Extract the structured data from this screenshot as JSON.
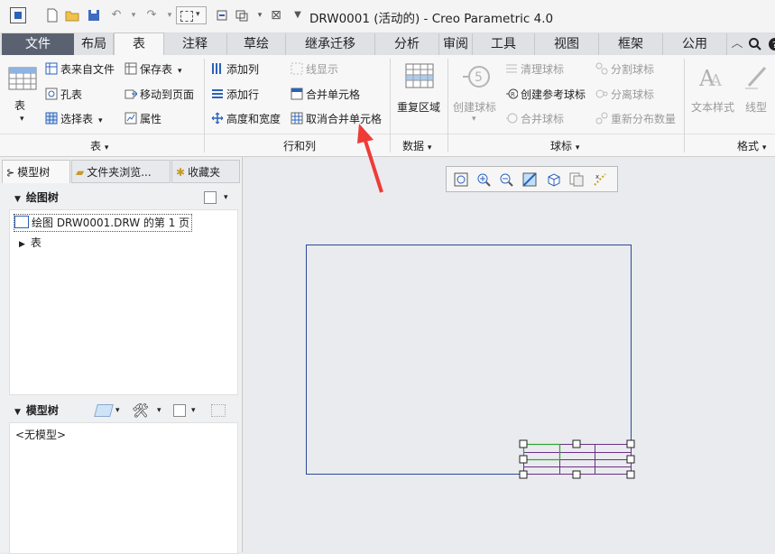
{
  "window": {
    "title": "DRW0001 (活动的) - Creo Parametric 4.0"
  },
  "tabs": [
    {
      "label": "文件"
    },
    {
      "label": "布局"
    },
    {
      "label": "表"
    },
    {
      "label": "注释"
    },
    {
      "label": "草绘"
    },
    {
      "label": "继承迁移"
    },
    {
      "label": "分析"
    },
    {
      "label": "审阅"
    },
    {
      "label": "工具"
    },
    {
      "label": "视图"
    },
    {
      "label": "框架"
    },
    {
      "label": "公用"
    }
  ],
  "ribbon": {
    "table_group": {
      "table": "表",
      "from_file": "表来自文件",
      "save_table": "保存表",
      "hole_table": "孔表",
      "move_to_page": "移动到页面",
      "select_table": "选择表",
      "properties": "属性",
      "label": "表"
    },
    "rows_cols_group": {
      "add_column": "添加列",
      "line_display": "线显示",
      "add_row": "添加行",
      "merge_cells": "合并单元格",
      "height_width": "高度和宽度",
      "unmerge_cells": "取消合并单元格",
      "label": "行和列"
    },
    "data_group": {
      "repeat_region": "重复区域",
      "label": "数据"
    },
    "balloon_group": {
      "create_balloon": "创建球标",
      "clean_balloons": "清理球标",
      "split_balloon": "分割球标",
      "create_ref_balloon": "创建参考球标",
      "detach_balloon": "分离球标",
      "merge_balloons": "合并球标",
      "redistribute_qty": "重新分布数量",
      "label": "球标"
    },
    "format_group": {
      "text_style": "文本样式",
      "line_style": "线型",
      "label": "格式"
    }
  },
  "left_panel": {
    "tabs": [
      {
        "label": "模型树"
      },
      {
        "label": "文件夹浏览..."
      },
      {
        "label": "收藏夹"
      }
    ],
    "drawing_tree": {
      "header": "绘图树",
      "items": [
        {
          "label": "绘图 DRW0001.DRW 的第 1 页"
        },
        {
          "label": "表"
        }
      ]
    },
    "model_tree": {
      "header": "模型树",
      "empty_text": "<无模型>"
    }
  },
  "colors": {
    "file_tab": "#5a6272",
    "sheet_border": "#2c4a9a",
    "table_lines": "#6b2f86",
    "selected_cell": "#2fa52f",
    "arrow": "#ef3b36"
  }
}
